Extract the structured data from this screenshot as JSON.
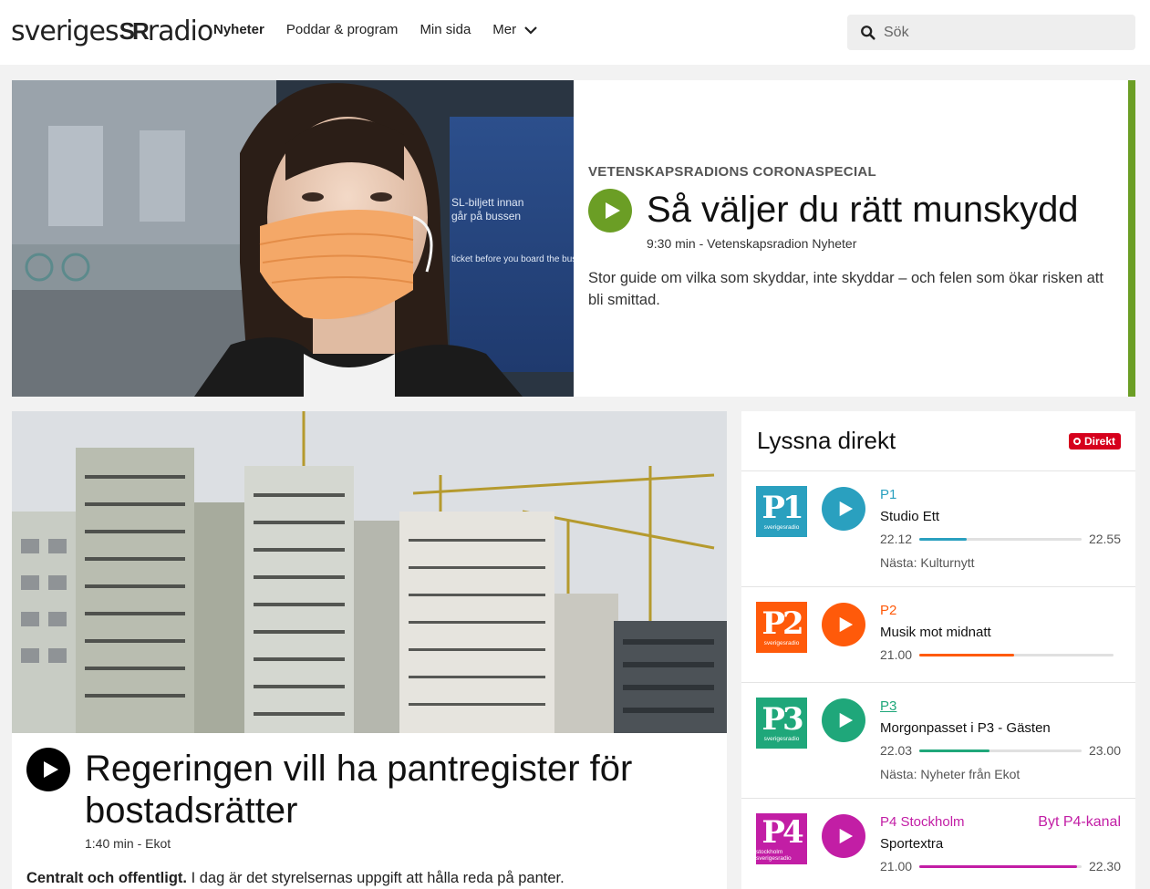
{
  "header": {
    "logo_left": "sveriges",
    "logo_mark": "SR",
    "logo_right": "radio",
    "nav": [
      "Nyheter",
      "Poddar & program",
      "Min sida",
      "Mer"
    ],
    "search_placeholder": "Sök"
  },
  "hero": {
    "kicker": "VETENSKAPSRADIONS CORONASPECIAL",
    "title": "Så väljer du rätt munskydd",
    "meta": "9:30 min - Vetenskapsradion Nyheter",
    "description": "Stor guide om vilka som skyddar, inte skyddar – och felen som ökar risken att bli smittad.",
    "accent": "#6b9e25",
    "image_sign_lines": [
      "SL-biljett innan",
      "går på bussen",
      "ticket before you board the bus"
    ]
  },
  "article": {
    "title": "Regeringen vill ha pantregister för bostadsrätter",
    "meta": "1:40 min - Ekot",
    "lead_bold": "Centralt och offentligt.",
    "lead_text": " I dag är det styrelsernas uppgift att hålla reda på panter."
  },
  "live": {
    "title": "Lyssna direkt",
    "badge": "Direkt",
    "channels": [
      {
        "logo": "P1",
        "logo_sub": "sverigesradio",
        "color": "#2aa0bf",
        "name": "P1",
        "show": "Studio Ett",
        "start": "22.12",
        "end": "22.55",
        "progress": 0.29,
        "next": "Nästa: Kulturnytt"
      },
      {
        "logo": "P2",
        "logo_sub": "sverigesradio",
        "color": "#ff5a0a",
        "name": "P2",
        "show": "Musik mot midnatt",
        "start": "21.00",
        "end": "",
        "progress": 0.49,
        "next": ""
      },
      {
        "logo": "P3",
        "logo_sub": "sverigesradio",
        "color": "#1fa77a",
        "name": "P3",
        "show": "Morgonpasset i P3 - Gästen",
        "start": "22.03",
        "end": "23.00",
        "progress": 0.43,
        "next": "Nästa: Nyheter från Ekot"
      },
      {
        "logo": "P4",
        "logo_sub": "stockholm sverigesradio",
        "color": "#c21ea5",
        "name": "P4 Stockholm",
        "show": "Sportextra",
        "start": "21.00",
        "end": "22.30",
        "progress": 0.97,
        "next": "",
        "extra": "Byt P4-kanal"
      }
    ]
  }
}
